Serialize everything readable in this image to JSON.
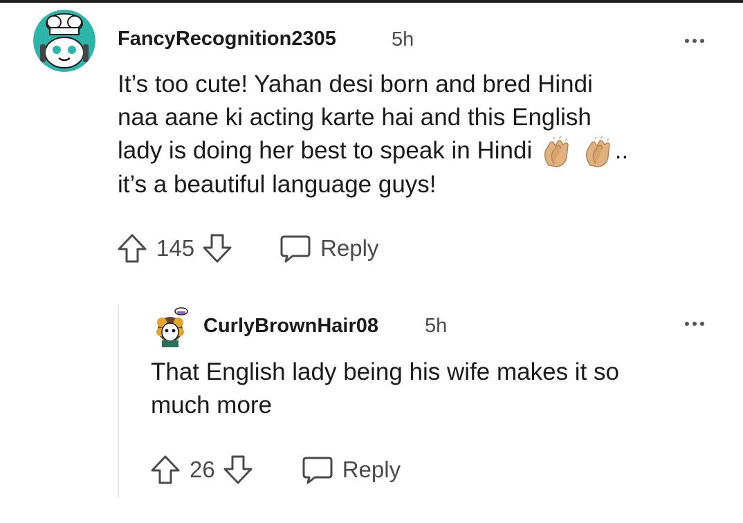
{
  "comments": [
    {
      "username": "FancyRecognition2305",
      "time": "5h",
      "body_lines": [
        "It’s too cute! Yahan desi born and bred Hindi",
        "naa aane ki acting karte hai and this English",
        "lady is doing her best to speak in Hindi",
        "it’s a beautiful language guys!"
      ],
      "body_suffix": "..",
      "score": "145",
      "reply_label": "Reply",
      "avatar_icon": "snoo-chef-avatar-icon"
    },
    {
      "username": "CurlyBrownHair08",
      "time": "5h",
      "body_lines": [
        "That English lady being his wife makes it so",
        "much more"
      ],
      "score": "26",
      "reply_label": "Reply",
      "avatar_icon": "curly-hair-avatar-icon"
    }
  ],
  "colors": {
    "text": "#1a1a1b",
    "meta": "#4a4a4a",
    "snoo_teal": "#2cb5a9",
    "clap": "#e0b27f"
  }
}
